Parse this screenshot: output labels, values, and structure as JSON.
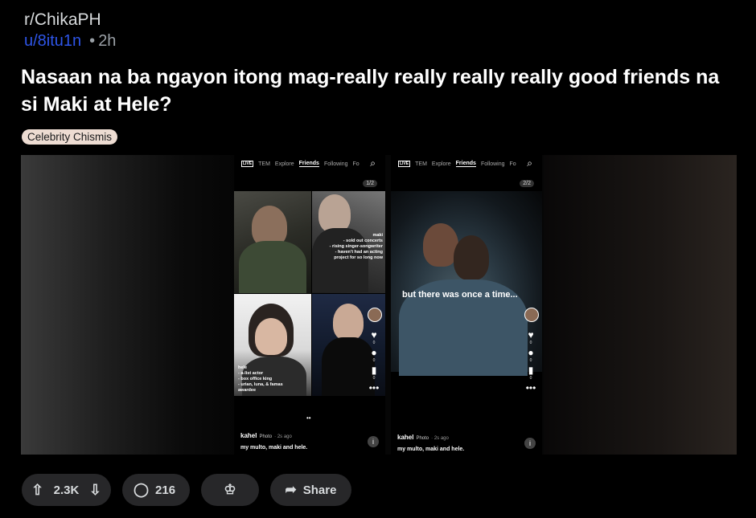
{
  "post": {
    "subreddit": "r/ChikaPH",
    "author": "u/8itu1n",
    "time": "2h",
    "title": "Nasaan na ba ngayon itong mag-really really really really good friends na si Maki at Hele?",
    "flair": "Celebrity Chismis"
  },
  "phone1": {
    "nav": {
      "live": "LIVE",
      "items": [
        "TEM",
        "Explore",
        "Friends",
        "Following",
        "Fo"
      ]
    },
    "counter": "1/2",
    "maki_caption": [
      "maki",
      "- sold out concerts",
      "- rising singer-songwriter",
      "- haven't had an acting",
      "project for so long now"
    ],
    "hele_caption": [
      "hele",
      "- a-list actor",
      "- box office king",
      "- urian, luna, & famas",
      "awardee"
    ],
    "likes": "0",
    "comments": "0",
    "saves": "0",
    "user": "kahel",
    "type": "Photo",
    "ago": "· 2s ago",
    "caption": "my multo, maki and hele."
  },
  "phone2": {
    "nav": {
      "live": "LIVE",
      "items": [
        "TEM",
        "Explore",
        "Friends",
        "Following",
        "Fo"
      ]
    },
    "counter": "2/2",
    "overlay": "but there was once a time...",
    "likes": "0",
    "comments": "0",
    "saves": "0",
    "user": "kahel",
    "type": "Photo",
    "ago": "· 2s ago",
    "caption": "my multo, maki and hele."
  },
  "actions": {
    "votes": "2.3K",
    "comments": "216",
    "share": "Share"
  },
  "icons": {
    "upvote": "arrow-up-icon",
    "downvote": "arrow-down-icon",
    "comment": "comment-bubble-icon",
    "award": "award-icon",
    "share": "share-arrow-icon"
  },
  "colors": {
    "author": "#2e55e8",
    "flair_bg": "#eddcd2",
    "pill_bg": "#272729"
  }
}
